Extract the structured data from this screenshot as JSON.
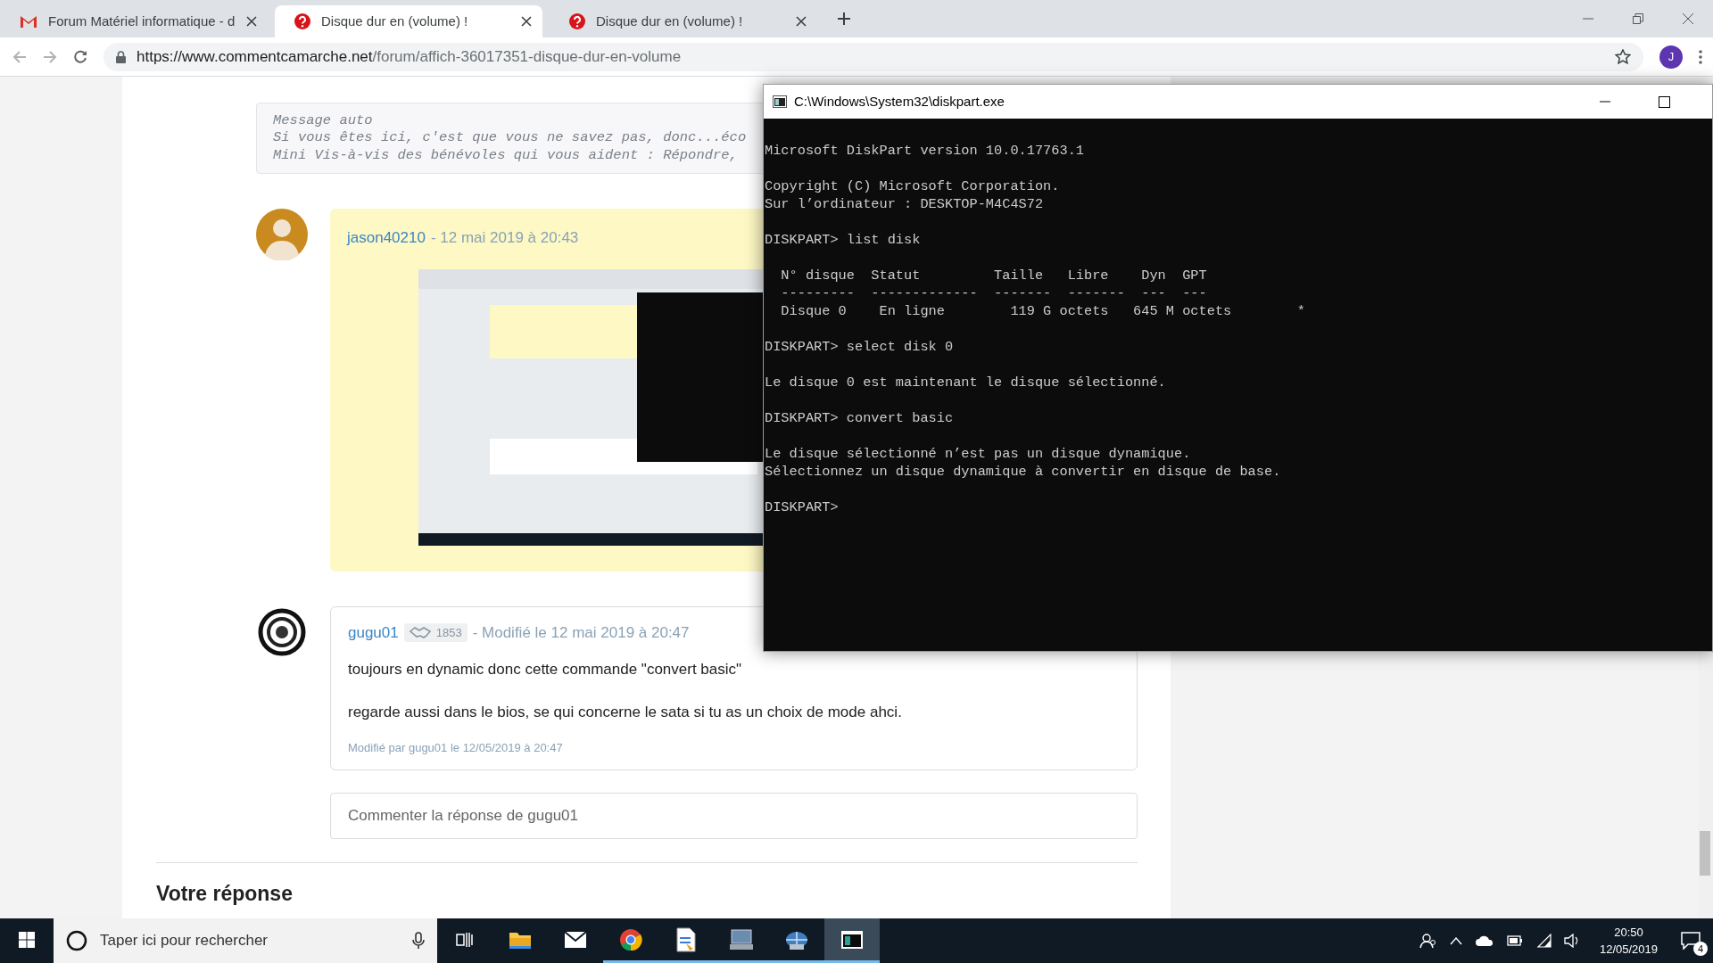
{
  "browser": {
    "tabs": [
      {
        "kind": "mail",
        "title": "Forum Matériel informatique - d",
        "selected": false
      },
      {
        "kind": "question",
        "title": "Disque dur en (volume) !",
        "selected": true
      },
      {
        "kind": "question",
        "title": "Disque dur en (volume) !",
        "selected": false
      }
    ],
    "address": {
      "host": "https://www.commentcamarche.net",
      "path": "/forum/affich-36017351-disque-dur-en-volume"
    },
    "profile_initial": "J"
  },
  "page": {
    "auto_message": [
      "Message auto",
      "Si vous êtes ici, c'est que vous ne savez pas, donc...éco",
      "Mini Vis-à-vis des bénévoles qui vous aident : Répondre,"
    ],
    "posts": [
      {
        "kind": "image",
        "highlighted": true,
        "author": "jason40210",
        "date": "- 12 mai 2019 à 20:43"
      },
      {
        "kind": "text",
        "highlighted": false,
        "author": "gugu01",
        "reputation": "1853",
        "date": "- Modifié le 12 mai 2019 à 20:47",
        "paragraphs": [
          "toujours en dynamic donc cette commande \"convert basic\"",
          "regarde aussi dans le bios, se qui concerne le sata si tu as un choix de mode ahci."
        ],
        "edit_note": "Modifié par gugu01 le 12/05/2019 à 20:47"
      }
    ],
    "comment_field": {
      "placeholder": "Commenter la réponse de gugu01"
    },
    "reply_heading": "Votre réponse"
  },
  "console": {
    "title": "C:\\Windows\\System32\\diskpart.exe",
    "blocks": [
      [
        "Microsoft DiskPart version 10.0.17763.1"
      ],
      [
        "Copyright (C) Microsoft Corporation.",
        "Sur l’ordinateur : DESKTOP-M4C4S72"
      ],
      [
        "DISKPART> list disk"
      ],
      [
        "  N° disque  Statut         Taille   Libre    Dyn  GPT",
        "  ---------  -------------  -------  -------  ---  ---",
        "  Disque 0    En ligne        119 G octets   645 M octets        *"
      ],
      [
        "DISKPART> select disk 0"
      ],
      [
        "Le disque 0 est maintenant le disque sélectionné."
      ],
      [
        "DISKPART> convert basic"
      ],
      [
        "Le disque sélectionné n’est pas un disque dynamique.",
        "Sélectionnez un disque dynamique à convertir en disque de base."
      ],
      [
        "DISKPART>"
      ]
    ]
  },
  "taskbar": {
    "search_placeholder": "Taper ici pour rechercher",
    "apps": [
      {
        "kind": "folder",
        "running": false,
        "selected": false
      },
      {
        "kind": "mail",
        "running": false,
        "selected": false
      },
      {
        "kind": "browser",
        "running": true,
        "selected": false
      },
      {
        "kind": "document",
        "running": true,
        "selected": false
      },
      {
        "kind": "monitor",
        "running": true,
        "selected": false
      },
      {
        "kind": "globe",
        "running": true,
        "selected": false
      },
      {
        "kind": "console",
        "running": true,
        "selected": true
      }
    ],
    "time": "20:50",
    "date": "12/05/2019",
    "notification_count": "4"
  }
}
